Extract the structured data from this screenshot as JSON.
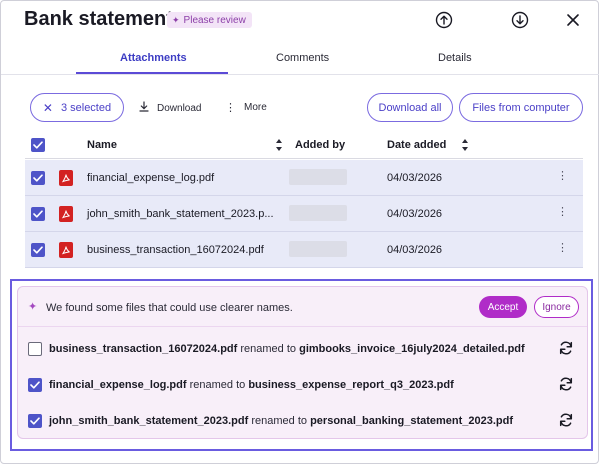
{
  "header": {
    "title": "Bank statement",
    "badge": "Please review",
    "icons": [
      "upload-icon",
      "download-icon",
      "close-icon"
    ]
  },
  "tabs": [
    {
      "label": "Attachments",
      "active": true
    },
    {
      "label": "Comments",
      "active": false
    },
    {
      "label": "Details",
      "active": false
    }
  ],
  "toolbar": {
    "selected_label": "3 selected",
    "download_label": "Download",
    "more_label": "More",
    "download_all_label": "Download all",
    "files_from_computer_label": "Files from computer"
  },
  "table": {
    "columns": [
      "Name",
      "Added by",
      "Date added"
    ],
    "rows": [
      {
        "name": "financial_expense_log.pdf",
        "date": "04/03/2026",
        "checked": true
      },
      {
        "name": "john_smith_bank_statement_2023.p...",
        "date": "04/03/2026",
        "checked": true
      },
      {
        "name": "business_transaction_16072024.pdf",
        "date": "04/03/2026",
        "checked": true
      }
    ]
  },
  "suggestions": {
    "message": "We found some files that could use clearer names.",
    "accept_label": "Accept",
    "ignore_label": "Ignore",
    "connector": "renamed to",
    "items": [
      {
        "from": "business_transaction_16072024.pdf",
        "to": "gimbooks_invoice_16july2024_detailed.pdf",
        "checked": false
      },
      {
        "from": "financial_expense_log.pdf",
        "to": "business_expense_report_q3_2023.pdf",
        "checked": true
      },
      {
        "from": "john_smith_bank_statement_2023.pdf",
        "to": "personal_banking_statement_2023.pdf",
        "checked": true
      }
    ]
  },
  "colors": {
    "accent": "#4e54c8",
    "accept": "#b02cc8",
    "pdf": "#d32222",
    "selected_row": "#e8eaf8",
    "suggestion_bg": "#f8eff9"
  }
}
